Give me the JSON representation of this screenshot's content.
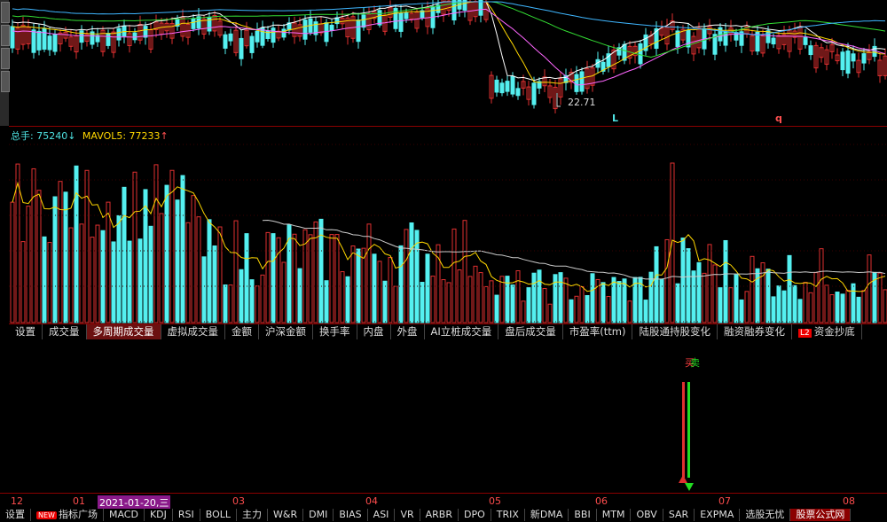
{
  "kline": {
    "low_price_label": "22.71",
    "markers": [
      "L",
      "q"
    ]
  },
  "volume": {
    "label_total": "总手: 75240",
    "label_mavol": "MAVOL5: 77233",
    "arrow_down": "↓",
    "arrow_up": "↑"
  },
  "indicator_tabs": [
    {
      "label": "设置"
    },
    {
      "label": "成交量"
    },
    {
      "label": "多周期成交量",
      "active": true
    },
    {
      "label": "虚拟成交量"
    },
    {
      "label": "金额"
    },
    {
      "label": "沪深金额"
    },
    {
      "label": "换手率"
    },
    {
      "label": "内盘"
    },
    {
      "label": "外盘"
    },
    {
      "label": "AI立桩成交量"
    },
    {
      "label": "盘后成交量"
    },
    {
      "label": "市盈率(ttm)"
    },
    {
      "label": "陆股通持股变化"
    },
    {
      "label": "融资融券变化"
    },
    {
      "label": "资金抄底",
      "badge": "L2"
    }
  ],
  "signal": {
    "text_a": "买",
    "text_b": "卖"
  },
  "time_axis": [
    {
      "label": "12"
    },
    {
      "label": "01"
    },
    {
      "label": "2021-01-20,三",
      "highlight": true
    },
    {
      "label": "03"
    },
    {
      "label": "04"
    },
    {
      "label": "05"
    },
    {
      "label": "06"
    },
    {
      "label": "07"
    },
    {
      "label": "08"
    }
  ],
  "bottom_tabs": [
    {
      "label": "设置"
    },
    {
      "label": "指标广场",
      "badge": "NEW"
    },
    {
      "label": "MACD"
    },
    {
      "label": "KDJ"
    },
    {
      "label": "RSI"
    },
    {
      "label": "BOLL"
    },
    {
      "label": "主力"
    },
    {
      "label": "W&R"
    },
    {
      "label": "DMI"
    },
    {
      "label": "BIAS"
    },
    {
      "label": "ASI"
    },
    {
      "label": "VR"
    },
    {
      "label": "ARBR"
    },
    {
      "label": "DPO"
    },
    {
      "label": "TRIX"
    },
    {
      "label": "新DMA"
    },
    {
      "label": "BBI"
    },
    {
      "label": "MTM"
    },
    {
      "label": "OBV"
    },
    {
      "label": "SAR"
    },
    {
      "label": "EXPMA"
    },
    {
      "label": "选股无忧"
    },
    {
      "label": "股票公式网",
      "brand": true
    }
  ],
  "colors": {
    "up": "#e03030",
    "down": "#54f0f0",
    "ma5": "#ffffff",
    "ma10": "#ffd700",
    "ma20": "#ff66ff",
    "ma60": "#33dd33",
    "ma120": "#3fb6ff"
  }
}
